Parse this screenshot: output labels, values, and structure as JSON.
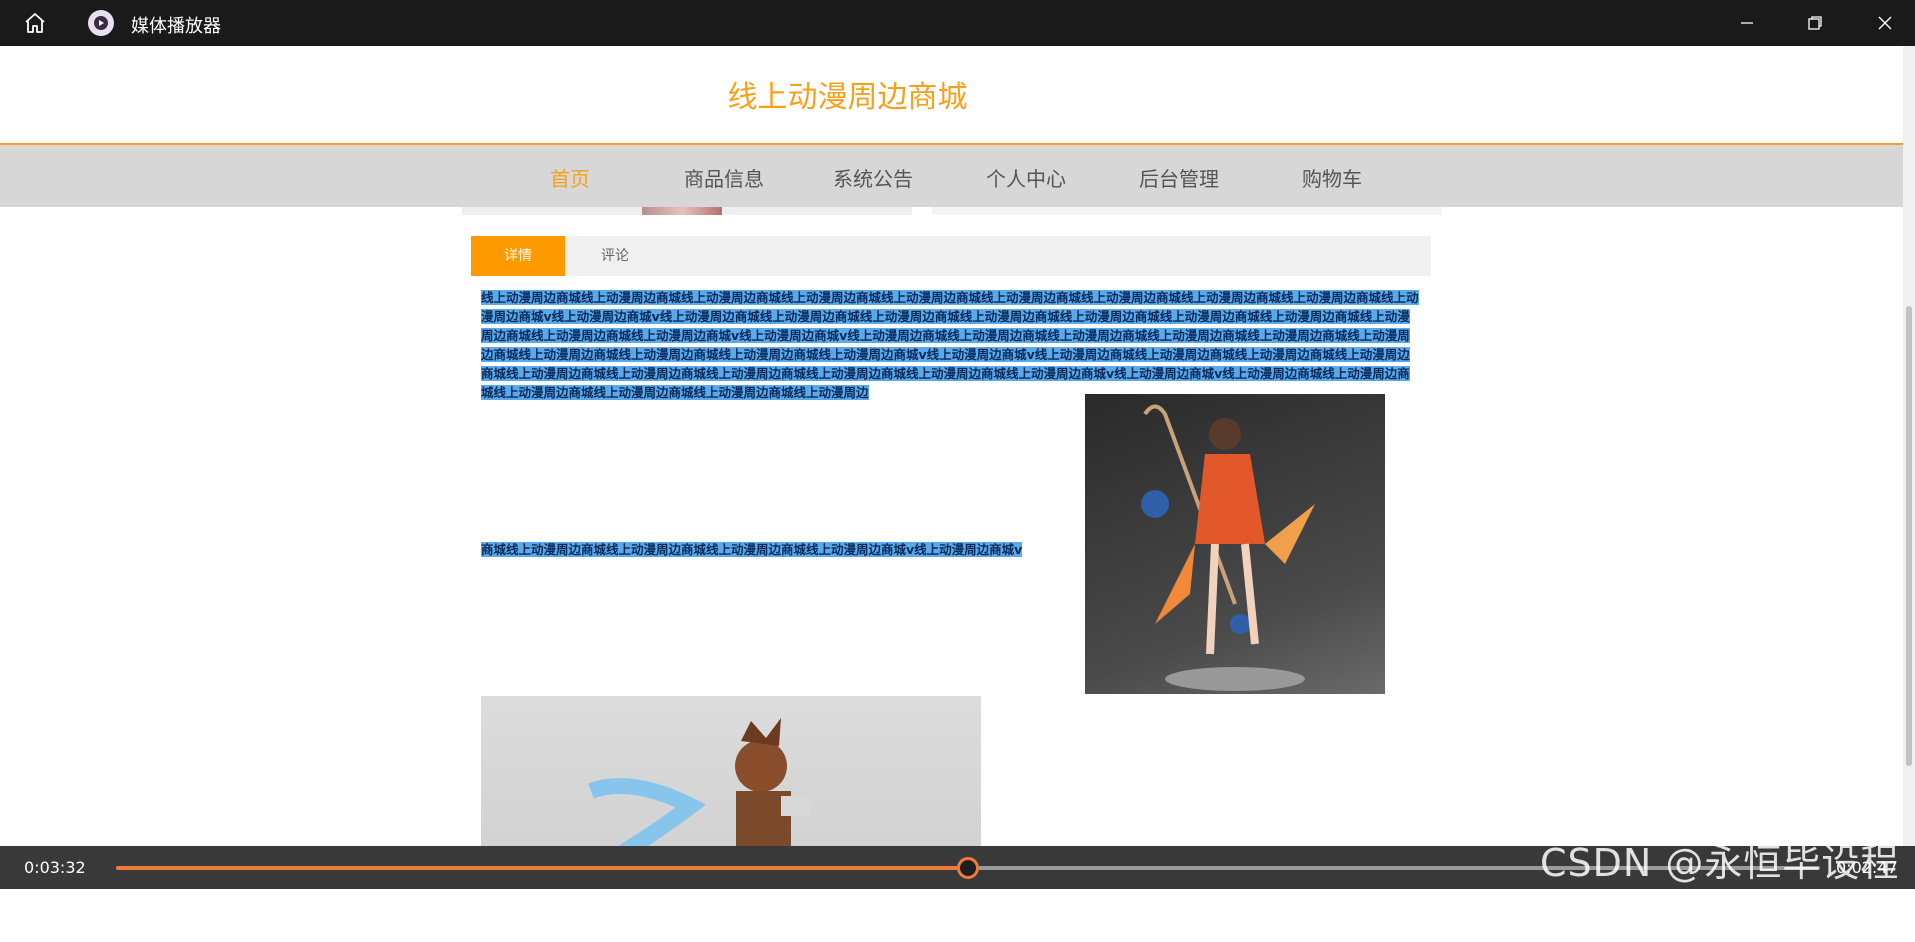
{
  "titlebar": {
    "app_title": "媒体播放器"
  },
  "site": {
    "title": "线上动漫周边商城",
    "nav": [
      "首页",
      "商品信息",
      "系统公告",
      "个人中心",
      "后台管理",
      "购物车"
    ],
    "active_nav": "首页"
  },
  "tabs": {
    "detail": "详情",
    "comments": "评论"
  },
  "content": {
    "paragraph": "线上动漫周边商城线上动漫周边商城线上动漫周边商城线上动漫周边商城线上动漫周边商城线上动漫周边商城线上动漫周边商城线上动漫周边商城线上动漫周边商城线上动漫周边商城v线上动漫周边商城v线上动漫周边商城线上动漫周边商城线上动漫周边商城线上动漫周边商城线上动漫周边商城线上动漫周边商城线上动漫周边商城线上动漫周边商城线上动漫周边商城线上动漫周边商城v线上动漫周边商城v线上动漫周边商城线上动漫周边商城线上动漫周边商城线上动漫周边商城线上动漫周边商城线上动漫周边商城线上动漫周边商城线上动漫周边商城线上动漫周边商城线上动漫周边商城v线上动漫周边商城v线上动漫周边商城线上动漫周边商城线上动漫周边商城线上动漫周边商城线上动漫周边商城线上动漫周边商城线上动漫周边商城线上动漫周边商城线上动漫周边商城线上动漫周边商城v线上动漫周边商城v线上动漫周边商城线上动漫周边商城线上动漫周边商城线上动漫周边商城线上动漫周边商城线上动漫周边",
    "line2": "商城线上动漫周边商城线上动漫周边商城线上动漫周边商城线上动漫周边商城v线上动漫周边商城v"
  },
  "player": {
    "elapsed": "0:03:32",
    "remaining": "0:02:47",
    "progress": 0.5
  },
  "watermark": "CSDN @永恒毕设程序",
  "colors": {
    "accent": "#f7a11a",
    "tab_active": "#ff9900",
    "selection": "#5aa9ea",
    "progress": "#f07a3a"
  }
}
